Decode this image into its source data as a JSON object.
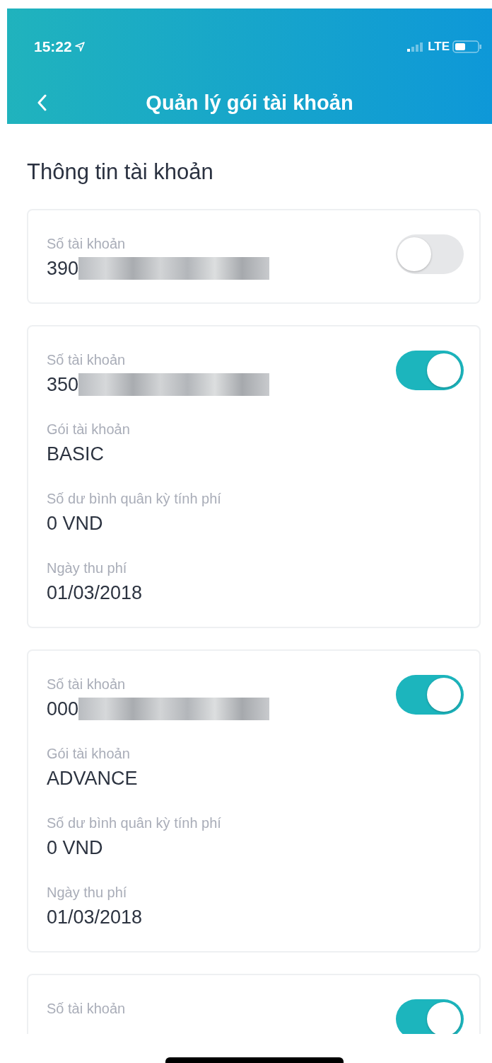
{
  "status_bar": {
    "time": "15:22",
    "network": "LTE"
  },
  "header": {
    "title": "Quản lý gói tài khoản"
  },
  "section_title": "Thông tin tài khoản",
  "accounts": [
    {
      "enabled": false,
      "fields": [
        {
          "kind": "account",
          "label": "Số tài khoản",
          "value": "390"
        }
      ]
    },
    {
      "enabled": true,
      "fields": [
        {
          "kind": "account",
          "label": "Số tài khoản",
          "value": "350"
        },
        {
          "kind": "text",
          "label": "Gói tài khoản",
          "value": "BASIC"
        },
        {
          "kind": "text",
          "label": "Số dư bình quân kỳ tính phí",
          "value": "0 VND"
        },
        {
          "kind": "text",
          "label": "Ngày thu phí",
          "value": "01/03/2018"
        }
      ]
    },
    {
      "enabled": true,
      "fields": [
        {
          "kind": "account",
          "label": "Số tài khoản",
          "value": "000"
        },
        {
          "kind": "text",
          "label": "Gói tài khoản",
          "value": "ADVANCE"
        },
        {
          "kind": "text",
          "label": "Số dư bình quân kỳ tính phí",
          "value": "0 VND"
        },
        {
          "kind": "text",
          "label": "Ngày thu phí",
          "value": "01/03/2018"
        }
      ]
    },
    {
      "enabled": true,
      "fields": [
        {
          "kind": "account",
          "label": "Số tài khoản"
        }
      ]
    }
  ]
}
